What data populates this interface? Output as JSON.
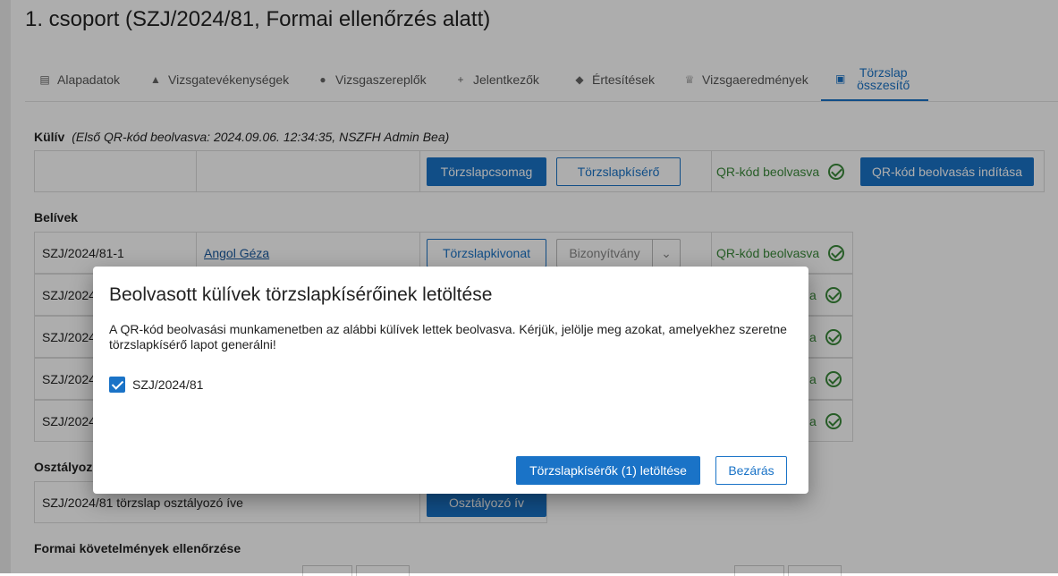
{
  "page": {
    "title": "1. csoport (SZJ/2024/81, Formai ellenőrzés alatt)"
  },
  "tabs": [
    {
      "label": "Alapadatok",
      "icon": "document-icon"
    },
    {
      "label": "Vizsgatevékenységek",
      "icon": "graduation-cap-icon"
    },
    {
      "label": "Vizsgaszereplők",
      "icon": "user-tie-icon"
    },
    {
      "label": "Jelentkezők",
      "icon": "user-plus-icon"
    },
    {
      "label": "Értesítések",
      "icon": "bell-icon"
    },
    {
      "label": "Vizsgaeredmények",
      "icon": "trophy-icon"
    },
    {
      "label": "Törzslap összesítő",
      "icon": "clipboard-icon",
      "active": true
    }
  ],
  "kuliv": {
    "label": "Külív",
    "note": "(Első QR-kód beolvasva: 2024.09.06. 12:34:35, NSZFH Admin Bea)",
    "btn_package": "Törzslapcsomag",
    "btn_accompany": "Törzslapkísérő",
    "qr_status": "QR-kód beolvasva",
    "btn_start_scan": "QR-kód beolvasás indítása"
  },
  "belivek": {
    "label": "Belívek",
    "rows": [
      {
        "code": "SZJ/2024/81-1",
        "name": "Angol Géza",
        "btn_extract": "Törzslapkivonat",
        "select": "Bizonyítvány",
        "qr_status": "QR-kód beolvasva"
      },
      {
        "code": "SZJ/2024",
        "qr_status": "a"
      },
      {
        "code": "SZJ/2024",
        "qr_status": "a"
      },
      {
        "code": "SZJ/2024",
        "qr_status": "a"
      },
      {
        "code": "SZJ/2024",
        "qr_status": "a"
      }
    ]
  },
  "osztalyozo": {
    "label": "Osztályozó",
    "row_text": "SZJ/2024/81 törzslap osztályozó íve",
    "btn": "Osztályozó ív"
  },
  "formai": {
    "label": "Formai követelmények ellenőrzése"
  },
  "modal": {
    "title": "Beolvasott külívek törzslapkísérőinek letöltése",
    "text": "A QR-kód beolvasási munkamenetben az alábbi külívek lettek beolvasva. Kérjük, jelölje meg azokat, amelyekhez szeretne törzslapkísérő lapot generálni!",
    "checkbox_label": "SZJ/2024/81",
    "checkbox_checked": true,
    "btn_download": "Törzslapkísérők (1) letöltése",
    "btn_close": "Bezárás"
  },
  "colors": {
    "accent": "#1a73c7",
    "success": "#3a8a3a"
  }
}
